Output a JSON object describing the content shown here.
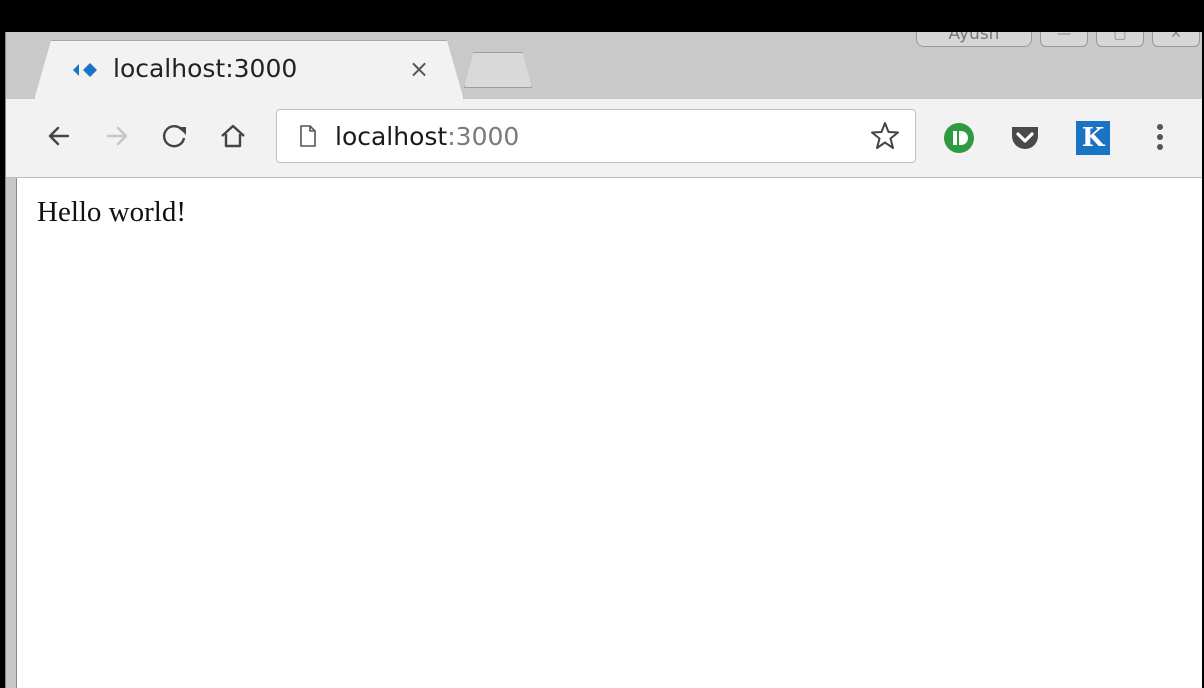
{
  "window": {
    "profile_name": "Ayush",
    "controls": {
      "minimize": "—",
      "maximize": "▢",
      "close": "✕"
    }
  },
  "tab": {
    "title": "localhost:3000",
    "close_label": "×",
    "favicon": "react-style-diamond-icon"
  },
  "toolbar": {
    "icons": [
      "back-arrow-icon",
      "forward-arrow-icon",
      "reload-icon",
      "home-icon"
    ],
    "omnibox": {
      "host": "localhost",
      "port": ":3000"
    },
    "extensions": [
      "green-power-extension-icon",
      "pocket-icon"
    ],
    "k_extension_label": "K"
  },
  "page": {
    "text": "Hello world!"
  },
  "colors": {
    "accent_blue": "#1a73c5",
    "extension_green": "#2f9a41",
    "pocket_gray": "#4a4a4a"
  }
}
